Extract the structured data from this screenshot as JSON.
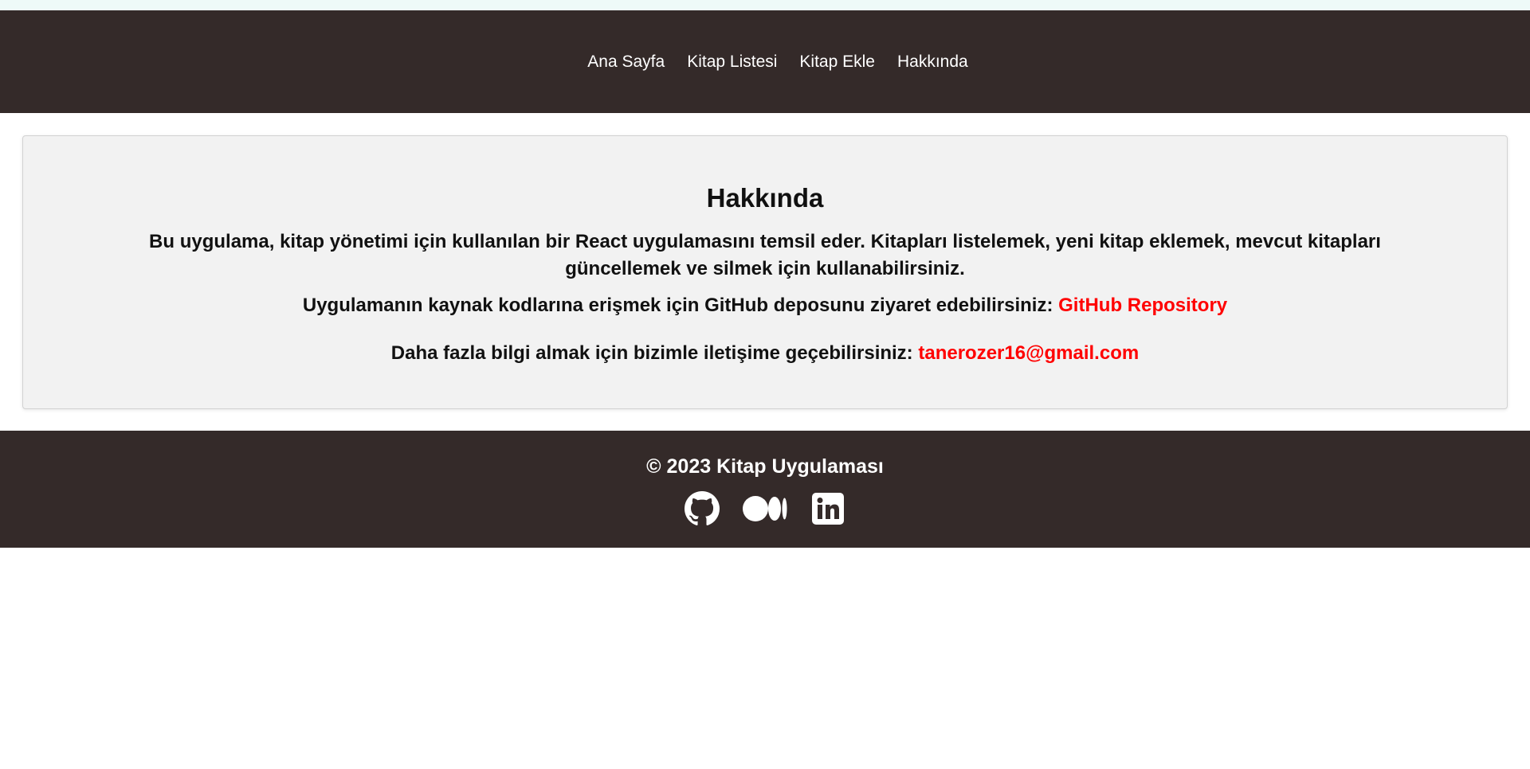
{
  "nav": {
    "items": [
      {
        "label": "Ana Sayfa"
      },
      {
        "label": "Kitap Listesi"
      },
      {
        "label": "Kitap Ekle"
      },
      {
        "label": "Hakkında"
      }
    ]
  },
  "about": {
    "title": "Hakkında",
    "description": "Bu uygulama, kitap yönetimi için kullanılan bir React uygulamasını temsil eder. Kitapları listelemek, yeni kitap eklemek, mevcut kitapları güncellemek ve silmek için kullanabilirsiniz.",
    "github_prefix": "Uygulamanın kaynak kodlarına erişmek için GitHub deposunu ziyaret edebilirsiniz:",
    "github_link": "GitHub Repository",
    "contact_prefix": "Daha fazla bilgi almak için bizimle iletişime geçebilirsiniz:",
    "contact_email": "tanerozer16@gmail.com"
  },
  "footer": {
    "copyright": "© 2023 Kitap Uygulaması",
    "social": [
      {
        "icon": "github-icon"
      },
      {
        "icon": "medium-icon"
      },
      {
        "icon": "linkedin-icon"
      }
    ]
  },
  "colors": {
    "header_bg": "#342a29",
    "card_bg": "#f2f2f2",
    "link_red": "#ff0000"
  }
}
